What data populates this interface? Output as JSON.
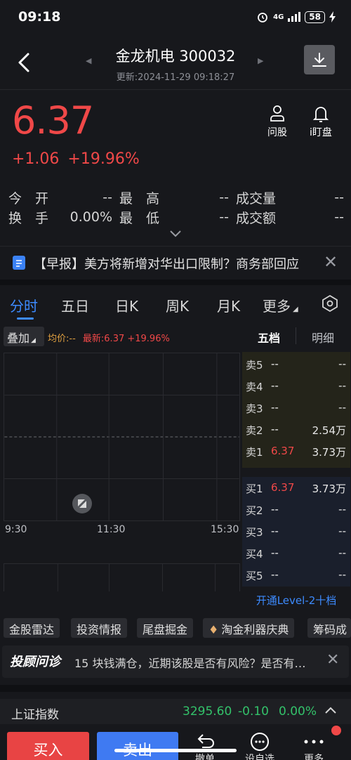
{
  "status_bar": {
    "time": "09:18",
    "network": "4G",
    "battery": "58"
  },
  "header": {
    "title": "金龙机电 300032",
    "subtitle": "更新:2024-11-29 09:18:27",
    "prev_icon": "triangle-left",
    "next_icon": "triangle-right",
    "download_icon": "download"
  },
  "quote": {
    "price": "6.37",
    "change": "+1.06",
    "change_pct": "+19.96%",
    "actions": [
      {
        "label": "问股"
      },
      {
        "label": "i盯盘"
      }
    ]
  },
  "stats": {
    "open_label": "今　开",
    "open_value": "--",
    "high_label": "最　高",
    "high_value": "--",
    "volume_label": "成交量",
    "volume_value": "--",
    "turnover_label": "换　手",
    "turnover_value": "0.00%",
    "low_label": "最　低",
    "low_value": "--",
    "amount_label": "成交额",
    "amount_value": "--"
  },
  "news": {
    "text": "【早报】美方将新增对华出口限制？商务部回应"
  },
  "tabs": [
    {
      "label": "分时",
      "active": true
    },
    {
      "label": "五日"
    },
    {
      "label": "日K"
    },
    {
      "label": "周K"
    },
    {
      "label": "月K"
    },
    {
      "label": "更多"
    }
  ],
  "chart": {
    "overlay_label": "叠加",
    "avg_label": "均价:--",
    "latest_label": "最新:6.37 +19.96%",
    "x_labels": [
      "9:30",
      "11:30",
      "15:30"
    ]
  },
  "order_book": {
    "tab_five": "五档",
    "tab_detail": "明细",
    "sell": [
      {
        "name": "卖5",
        "price": "--",
        "vol": "--"
      },
      {
        "name": "卖4",
        "price": "--",
        "vol": "--"
      },
      {
        "name": "卖3",
        "price": "--",
        "vol": "--"
      },
      {
        "name": "卖2",
        "price": "--",
        "vol": "2.54万"
      },
      {
        "name": "卖1",
        "price": "6.37",
        "vol": "3.73万"
      }
    ],
    "buy": [
      {
        "name": "买1",
        "price": "6.37",
        "vol": "3.73万"
      },
      {
        "name": "买2",
        "price": "--",
        "vol": "--"
      },
      {
        "name": "买3",
        "price": "--",
        "vol": "--"
      },
      {
        "name": "买4",
        "price": "--",
        "vol": "--"
      },
      {
        "name": "买5",
        "price": "--",
        "vol": "--"
      }
    ],
    "level2_label": "开通Level-2十档"
  },
  "tools": [
    "金股雷达",
    "投资情报",
    "尾盘掘金",
    "淘金利器庆典",
    "筹码成"
  ],
  "advisor": {
    "logo": "投顾问诊",
    "text": "15 块钱满仓，近期该股是否有风险？是否有机会"
  },
  "index": {
    "name": "上证指数",
    "value": "3295.60",
    "change": "-0.10",
    "pct": "0.00%"
  },
  "bottom": {
    "buy": "买入",
    "sell": "卖出",
    "items": [
      {
        "label": "撤单"
      },
      {
        "label": "设自选"
      },
      {
        "label": "更多"
      }
    ]
  },
  "colors": {
    "up": "#f04848",
    "down": "#33c26a",
    "accent": "#3d8bff",
    "background": "#17181c"
  }
}
